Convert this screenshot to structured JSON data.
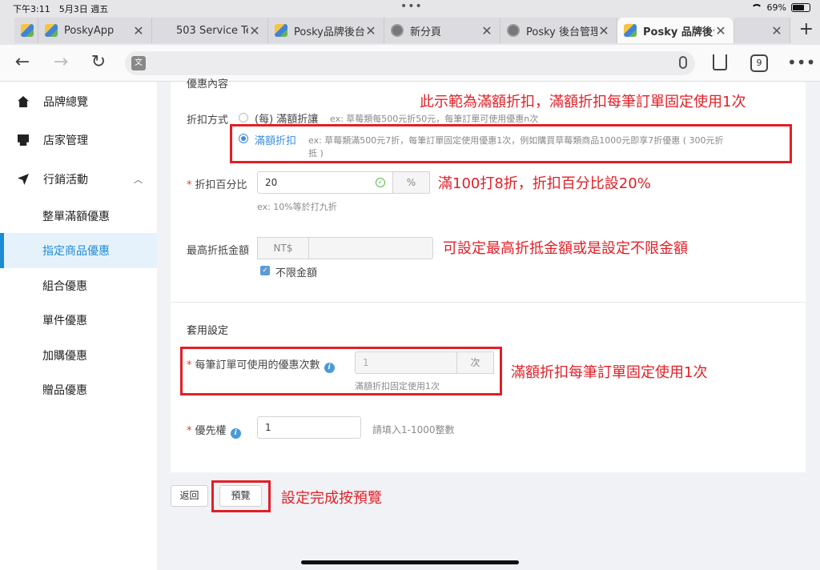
{
  "status": {
    "time": "下午3:11　5月3日 週五",
    "battery": "69%",
    "battery_level": 0.69
  },
  "tabs": [
    {
      "title": "",
      "favicon": "posky-logo-icon",
      "active": false
    },
    {
      "title": "PoskyApp",
      "favicon": "posky-logo-icon",
      "active": false
    },
    {
      "title": "503 Service Te",
      "favicon": "none",
      "active": false
    },
    {
      "title": "Posky品牌後台",
      "favicon": "posky-logo-icon",
      "active": false
    },
    {
      "title": "新分頁",
      "favicon": "globe-icon",
      "active": false
    },
    {
      "title": "Posky 後台管理",
      "favicon": "globe-icon",
      "active": false
    },
    {
      "title": "Posky 品牌後台",
      "favicon": "posky-logo-icon",
      "active": true
    },
    {
      "title": "",
      "favicon": "none",
      "active": false
    }
  ],
  "toolbar": {
    "tab_count": "9"
  },
  "sidebar": {
    "items": [
      {
        "label": "品牌總覽",
        "icon": "home-icon"
      },
      {
        "label": "店家管理",
        "icon": "store-icon"
      },
      {
        "label": "行銷活動",
        "icon": "send-icon"
      }
    ],
    "sub_items": [
      {
        "label": "整單滿額優惠",
        "active": false
      },
      {
        "label": "指定商品優惠",
        "active": true
      },
      {
        "label": "組合優惠",
        "active": false
      },
      {
        "label": "單件優惠",
        "active": false
      },
      {
        "label": "加購優惠",
        "active": false
      },
      {
        "label": "贈品優惠",
        "active": false
      }
    ]
  },
  "form": {
    "section_title": "優惠內容",
    "discount_method_label": "折扣方式",
    "option1_label": "(每) 滿額折讓",
    "option1_hint": "ex: 草莓類每500元折50元，每筆訂單可使用優惠n次",
    "option2_label": "滿額折扣",
    "option2_hint_line1": "ex: 草莓類滿500元7折，每筆訂單固定使用優惠1次，例如購買草莓類商品1000元即享7折優惠 ( 300元折",
    "option2_hint_line2": "抵 )",
    "percent_label": "折扣百分比",
    "percent_value": "20",
    "percent_unit": "%",
    "percent_hint": "ex: 10%等於打九折",
    "max_label": "最高折抵金額",
    "max_prefix": "NT$",
    "max_value": "",
    "unlimited_label": "不限金額",
    "apply_title": "套用設定",
    "uses_label": "每筆訂單可使用的優惠次數",
    "uses_value": "1",
    "uses_unit": "次",
    "uses_hint": "滿額折扣固定使用1次",
    "priority_label": "優先權",
    "priority_value": "1",
    "priority_hint": "請填入1-1000整數"
  },
  "buttons": {
    "back": "返回",
    "preview": "預覽"
  },
  "annotations": {
    "a1": "此示範為滿額折扣，滿額折扣每筆訂單固定使用1次",
    "a2": "滿100打8折，折扣百分比設20%",
    "a3": "可設定最高折抵金額或是設定不限金額",
    "a4": "滿額折扣每筆訂單固定使用1次",
    "a5": "設定完成按預覽"
  },
  "colors": {
    "accent": "#1b8bd6",
    "annotation_red": "#e21f26"
  }
}
